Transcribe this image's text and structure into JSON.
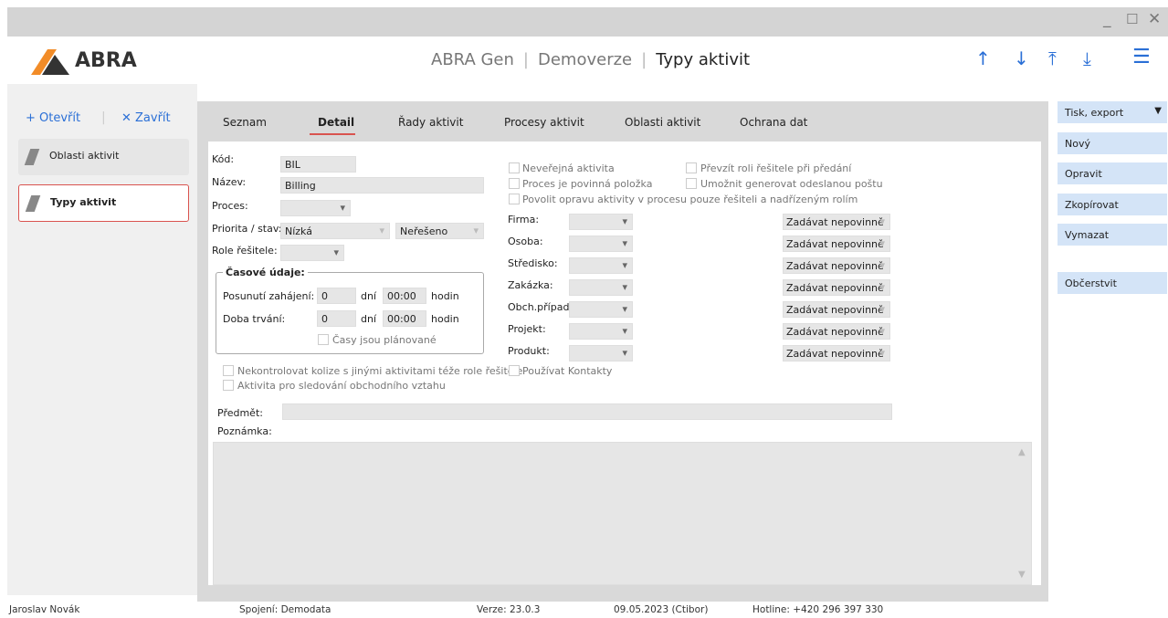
{
  "window": {
    "min": "_",
    "max": "☐",
    "close": "✕"
  },
  "header": {
    "logo": "ABRA",
    "crumb1": "ABRA Gen",
    "crumb2": "Demoverze",
    "current": "Typy aktivit"
  },
  "nav": {
    "up": "↑",
    "down": "↓",
    "first": "⤒",
    "last": "⤓",
    "menu": "☰"
  },
  "left": {
    "open": "+ Otevřít",
    "close": "✕ Zavřít",
    "items": [
      {
        "label": "Oblasti aktivit"
      },
      {
        "label": "Typy aktivit"
      }
    ]
  },
  "tabs": [
    "Seznam",
    "Detail",
    "Řady aktivit",
    "Procesy aktivit",
    "Oblasti aktivit",
    "Ochrana dat"
  ],
  "form": {
    "kod_label": "Kód:",
    "kod": "BIL",
    "nazev_label": "Název:",
    "nazev": "Billing",
    "proces_label": "Proces:",
    "priorita_label": "Priorita / stav:",
    "priorita": "Nízká",
    "stav": "Neřešeno",
    "role_label": "Role řešitele:",
    "casove_label": "Časové údaje:",
    "posunuti_label": "Posunutí zahájení:",
    "posunuti_dni": "0",
    "posunuti_cas": "00:00",
    "doba_label": "Doba trvání:",
    "doba_dni": "0",
    "doba_cas": "00:00",
    "dni": "dní",
    "hodin": "hodin",
    "casy_planovane": "Časy jsou plánované",
    "nekontrolovat": "Nekontrolovat kolize s jinými aktivitami téže role řešitele",
    "aktivita_sledovani": "Aktivita pro sledování obchodního vztahu",
    "neverejna": "Neveřejná aktivita",
    "proces_povinna": "Proces je povinná položka",
    "povolit_opravu": "Povolit opravu aktivity v procesu pouze řešiteli a nadřízeným rolím",
    "prevzit_roli": "Převzít roli řešitele při předání",
    "umoznit_generovat": "Umožnit generovat odeslanou poštu",
    "pouzivat_kontakty": "Používat Kontakty",
    "predmet_label": "Předmět:",
    "poznamka_label": "Poznámka:",
    "fields": [
      {
        "label": "Firma:",
        "mode": "Zadávat nepovinně"
      },
      {
        "label": "Osoba:",
        "mode": "Zadávat nepovinně"
      },
      {
        "label": "Středisko:",
        "mode": "Zadávat nepovinně"
      },
      {
        "label": "Zakázka:",
        "mode": "Zadávat nepovinně"
      },
      {
        "label": "Obch.případ:",
        "mode": "Zadávat nepovinně"
      },
      {
        "label": "Projekt:",
        "mode": "Zadávat nepovinně"
      },
      {
        "label": "Produkt:",
        "mode": "Zadávat nepovinně"
      }
    ]
  },
  "actions": {
    "tisk": "Tisk, export",
    "novy": "Nový",
    "opravit": "Opravit",
    "zkopirovat": "Zkopírovat",
    "vymazat": "Vymazat",
    "obcerstvit": "Občerstvit"
  },
  "status": {
    "user": "Jaroslav Novák",
    "spojeni": "Spojení: Demodata",
    "verze": "Verze: 23.0.3",
    "datum": "09.05.2023 (Ctibor)",
    "hotline": "Hotline: +420 296 397 330"
  },
  "colors": {
    "accent": "#2a6fd6",
    "active_tab": "#d9534f",
    "logo_orange": "#f28c28"
  }
}
